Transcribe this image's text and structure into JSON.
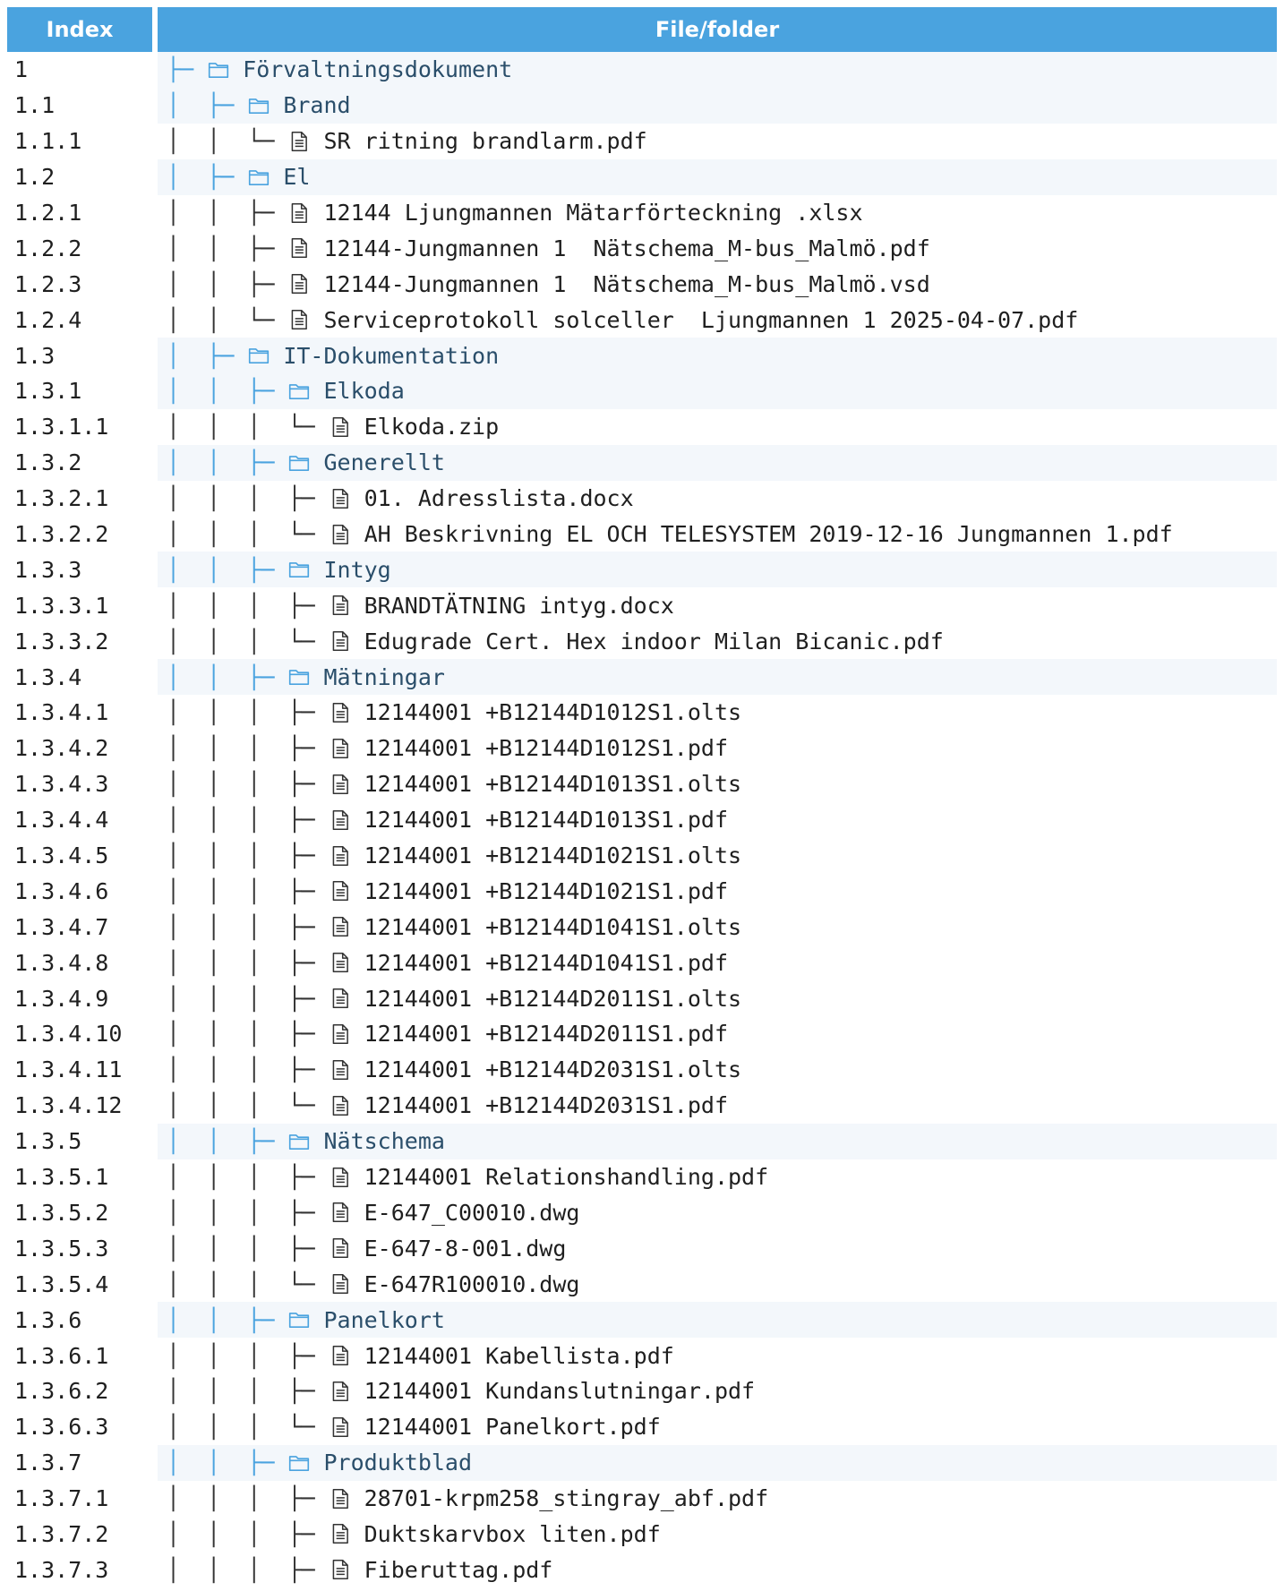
{
  "headers": {
    "index": "Index",
    "file": "File/folder"
  },
  "rows": [
    {
      "index": "1",
      "prefix": "├─ ",
      "type": "folder",
      "name": "Förvaltningsdokument"
    },
    {
      "index": "1.1",
      "prefix": "│  ├─ ",
      "type": "folder",
      "name": "Brand"
    },
    {
      "index": "1.1.1",
      "prefix": "│  │  └─ ",
      "type": "file",
      "name": "SR ritning brandlarm.pdf"
    },
    {
      "index": "1.2",
      "prefix": "│  ├─ ",
      "type": "folder",
      "name": "El"
    },
    {
      "index": "1.2.1",
      "prefix": "│  │  ├─ ",
      "type": "file",
      "name": "12144 Ljungmannen Mätarförteckning .xlsx"
    },
    {
      "index": "1.2.2",
      "prefix": "│  │  ├─ ",
      "type": "file",
      "name": "12144-Jungmannen 1  Nätschema_M-bus_Malmö.pdf"
    },
    {
      "index": "1.2.3",
      "prefix": "│  │  ├─ ",
      "type": "file",
      "name": "12144-Jungmannen 1  Nätschema_M-bus_Malmö.vsd"
    },
    {
      "index": "1.2.4",
      "prefix": "│  │  └─ ",
      "type": "file",
      "name": "Serviceprotokoll solceller  Ljungmannen 1 2025-04-07.pdf"
    },
    {
      "index": "1.3",
      "prefix": "│  ├─ ",
      "type": "folder",
      "name": "IT-Dokumentation"
    },
    {
      "index": "1.3.1",
      "prefix": "│  │  ├─ ",
      "type": "folder",
      "name": "Elkoda"
    },
    {
      "index": "1.3.1.1",
      "prefix": "│  │  │  └─ ",
      "type": "file",
      "name": "Elkoda.zip"
    },
    {
      "index": "1.3.2",
      "prefix": "│  │  ├─ ",
      "type": "folder",
      "name": "Generellt"
    },
    {
      "index": "1.3.2.1",
      "prefix": "│  │  │  ├─ ",
      "type": "file",
      "name": "01. Adresslista.docx"
    },
    {
      "index": "1.3.2.2",
      "prefix": "│  │  │  └─ ",
      "type": "file",
      "name": "AH Beskrivning EL OCH TELESYSTEM 2019-12-16 Jungmannen 1.pdf"
    },
    {
      "index": "1.3.3",
      "prefix": "│  │  ├─ ",
      "type": "folder",
      "name": "Intyg"
    },
    {
      "index": "1.3.3.1",
      "prefix": "│  │  │  ├─ ",
      "type": "file",
      "name": "BRANDTÄTNING intyg.docx"
    },
    {
      "index": "1.3.3.2",
      "prefix": "│  │  │  └─ ",
      "type": "file",
      "name": "Edugrade Cert. Hex indoor Milan Bicanic.pdf"
    },
    {
      "index": "1.3.4",
      "prefix": "│  │  ├─ ",
      "type": "folder",
      "name": "Mätningar"
    },
    {
      "index": "1.3.4.1",
      "prefix": "│  │  │  ├─ ",
      "type": "file",
      "name": "12144001 +B12144D1012S1.olts"
    },
    {
      "index": "1.3.4.2",
      "prefix": "│  │  │  ├─ ",
      "type": "file",
      "name": "12144001 +B12144D1012S1.pdf"
    },
    {
      "index": "1.3.4.3",
      "prefix": "│  │  │  ├─ ",
      "type": "file",
      "name": "12144001 +B12144D1013S1.olts"
    },
    {
      "index": "1.3.4.4",
      "prefix": "│  │  │  ├─ ",
      "type": "file",
      "name": "12144001 +B12144D1013S1.pdf"
    },
    {
      "index": "1.3.4.5",
      "prefix": "│  │  │  ├─ ",
      "type": "file",
      "name": "12144001 +B12144D1021S1.olts"
    },
    {
      "index": "1.3.4.6",
      "prefix": "│  │  │  ├─ ",
      "type": "file",
      "name": "12144001 +B12144D1021S1.pdf"
    },
    {
      "index": "1.3.4.7",
      "prefix": "│  │  │  ├─ ",
      "type": "file",
      "name": "12144001 +B12144D1041S1.olts"
    },
    {
      "index": "1.3.4.8",
      "prefix": "│  │  │  ├─ ",
      "type": "file",
      "name": "12144001 +B12144D1041S1.pdf"
    },
    {
      "index": "1.3.4.9",
      "prefix": "│  │  │  ├─ ",
      "type": "file",
      "name": "12144001 +B12144D2011S1.olts"
    },
    {
      "index": "1.3.4.10",
      "prefix": "│  │  │  ├─ ",
      "type": "file",
      "name": "12144001 +B12144D2011S1.pdf"
    },
    {
      "index": "1.3.4.11",
      "prefix": "│  │  │  ├─ ",
      "type": "file",
      "name": "12144001 +B12144D2031S1.olts"
    },
    {
      "index": "1.3.4.12",
      "prefix": "│  │  │  └─ ",
      "type": "file",
      "name": "12144001 +B12144D2031S1.pdf"
    },
    {
      "index": "1.3.5",
      "prefix": "│  │  ├─ ",
      "type": "folder",
      "name": "Nätschema"
    },
    {
      "index": "1.3.5.1",
      "prefix": "│  │  │  ├─ ",
      "type": "file",
      "name": "12144001 Relationshandling.pdf"
    },
    {
      "index": "1.3.5.2",
      "prefix": "│  │  │  ├─ ",
      "type": "file",
      "name": "E-647_C00010.dwg"
    },
    {
      "index": "1.3.5.3",
      "prefix": "│  │  │  ├─ ",
      "type": "file",
      "name": "E-647-8-001.dwg"
    },
    {
      "index": "1.3.5.4",
      "prefix": "│  │  │  └─ ",
      "type": "file",
      "name": "E-647R100010.dwg"
    },
    {
      "index": "1.3.6",
      "prefix": "│  │  ├─ ",
      "type": "folder",
      "name": "Panelkort"
    },
    {
      "index": "1.3.6.1",
      "prefix": "│  │  │  ├─ ",
      "type": "file",
      "name": "12144001 Kabellista.pdf"
    },
    {
      "index": "1.3.6.2",
      "prefix": "│  │  │  ├─ ",
      "type": "file",
      "name": "12144001 Kundanslutningar.pdf"
    },
    {
      "index": "1.3.6.3",
      "prefix": "│  │  │  └─ ",
      "type": "file",
      "name": "12144001 Panelkort.pdf"
    },
    {
      "index": "1.3.7",
      "prefix": "│  │  ├─ ",
      "type": "folder",
      "name": "Produktblad"
    },
    {
      "index": "1.3.7.1",
      "prefix": "│  │  │  ├─ ",
      "type": "file",
      "name": "28701-krpm258_stingray_abf.pdf"
    },
    {
      "index": "1.3.7.2",
      "prefix": "│  │  │  ├─ ",
      "type": "file",
      "name": "Duktskarvbox liten.pdf"
    },
    {
      "index": "1.3.7.3",
      "prefix": "│  │  │  ├─ ",
      "type": "file",
      "name": "Fiberuttag.pdf"
    }
  ],
  "colors": {
    "header_bg": "#4aa3df",
    "folder_row_bg": "#f3f7fb",
    "folder_text": "#2a4e6a"
  }
}
